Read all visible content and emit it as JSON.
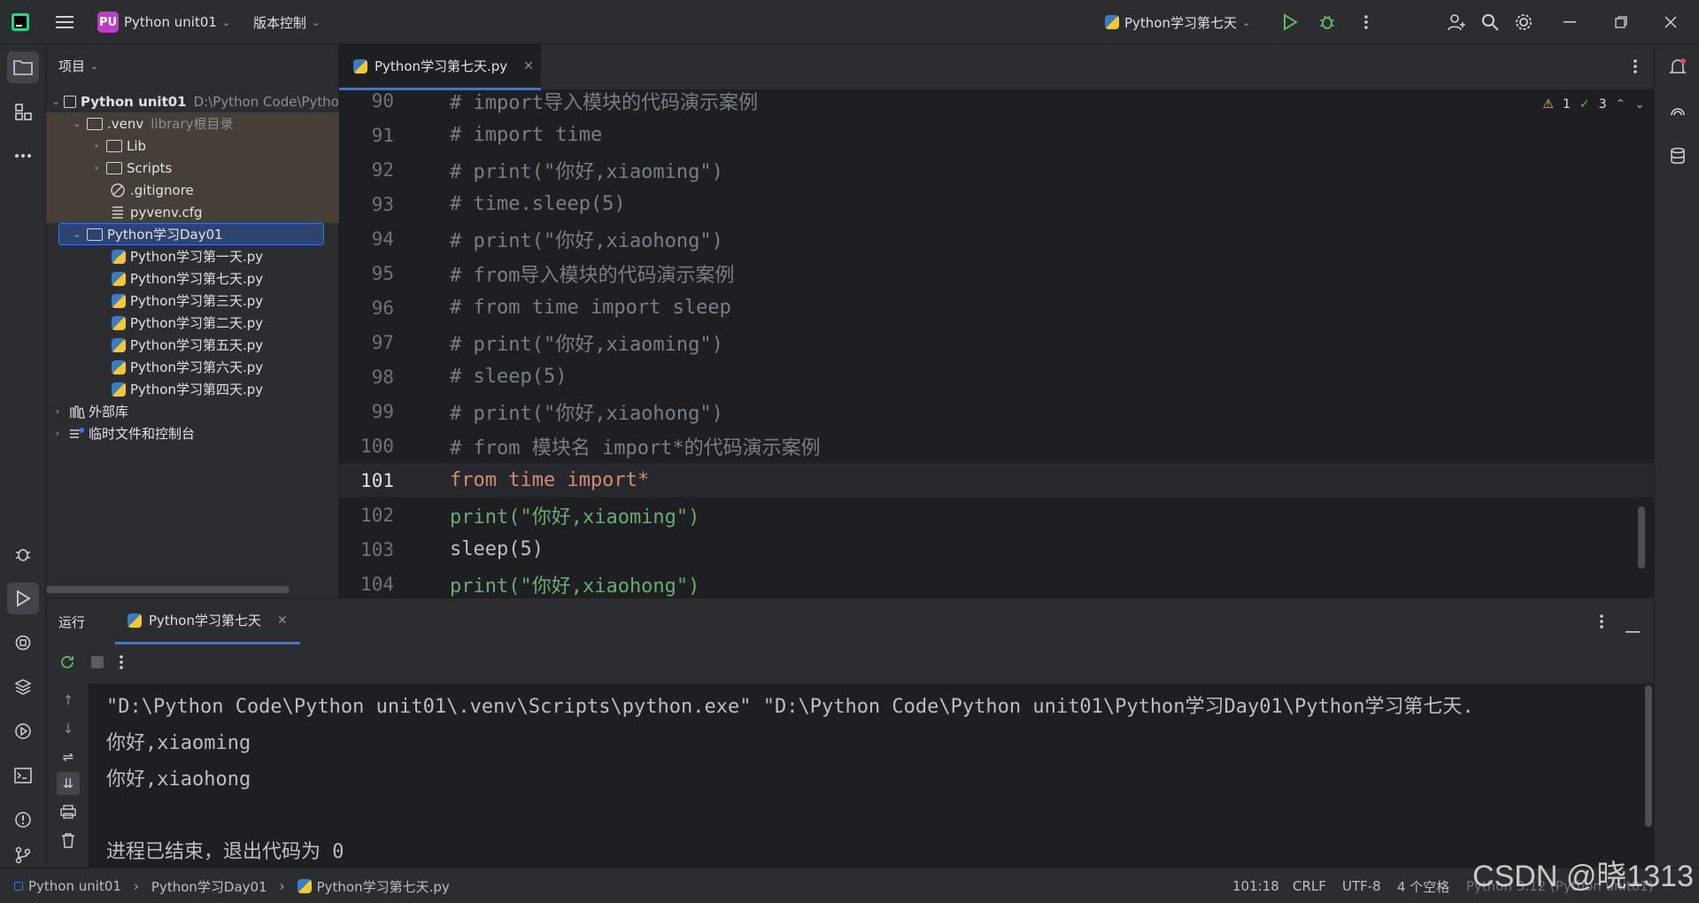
{
  "titlebar": {
    "project_badge": "PU",
    "project_name": "Python unit01",
    "vcs_label": "版本控制",
    "run_config": "Python学习第七天"
  },
  "project_panel": {
    "header": "项目",
    "tree": [
      {
        "label": "Python unit01",
        "sub": "D:\\Python Code\\Pytho",
        "type": "root"
      },
      {
        "label": ".venv",
        "sub": "library根目录",
        "type": "folder"
      },
      {
        "label": "Lib",
        "type": "folder"
      },
      {
        "label": "Scripts",
        "type": "folder"
      },
      {
        "label": ".gitignore",
        "type": "file"
      },
      {
        "label": "pyvenv.cfg",
        "type": "file"
      },
      {
        "label": "Python学习Day01",
        "type": "folder"
      },
      {
        "label": "Python学习第一天.py",
        "type": "py"
      },
      {
        "label": "Python学习第七天.py",
        "type": "py"
      },
      {
        "label": "Python学习第三天.py",
        "type": "py"
      },
      {
        "label": "Python学习第二天.py",
        "type": "py"
      },
      {
        "label": "Python学习第五天.py",
        "type": "py"
      },
      {
        "label": "Python学习第六天.py",
        "type": "py"
      },
      {
        "label": "Python学习第四天.py",
        "type": "py"
      },
      {
        "label": "外部库",
        "type": "lib"
      },
      {
        "label": "临时文件和控制台",
        "type": "scratch"
      }
    ]
  },
  "editor": {
    "tab_label": "Python学习第七天.py",
    "warnings": "1",
    "checks": "3",
    "lines": [
      {
        "n": "90",
        "text": "# import导入模块的代码演示案例"
      },
      {
        "n": "91",
        "text": "# import time"
      },
      {
        "n": "92",
        "text": "# print(\"你好,xiaoming\")"
      },
      {
        "n": "93",
        "text": "# time.sleep(5)"
      },
      {
        "n": "94",
        "text": "# print(\"你好,xiaohong\")"
      },
      {
        "n": "95",
        "text": "# from导入模块的代码演示案例"
      },
      {
        "n": "96",
        "text": "# from time import sleep"
      },
      {
        "n": "97",
        "text": "# print(\"你好,xiaoming\")"
      },
      {
        "n": "98",
        "text": "# sleep(5)"
      },
      {
        "n": "99",
        "text": "# print(\"你好,xiaohong\")"
      },
      {
        "n": "100",
        "text": "# from 模块名 import*的代码演示案例"
      },
      {
        "n": "101",
        "text": "from time import*"
      },
      {
        "n": "102",
        "text": "print(\"你好,xiaoming\")"
      },
      {
        "n": "103",
        "text": "sleep(5)"
      },
      {
        "n": "104",
        "text": "print(\"你好,xiaohong\")"
      }
    ]
  },
  "run_panel": {
    "title": "运行",
    "tab_label": "Python学习第七天",
    "console": [
      "\"D:\\Python Code\\Python unit01\\.venv\\Scripts\\python.exe\" \"D:\\Python Code\\Python unit01\\Python学习Day01\\Python学习第七天.",
      "你好,xiaoming",
      "你好,xiaohong",
      "",
      "进程已结束，退出代码为 0"
    ]
  },
  "statusbar": {
    "crumbs": [
      "Python unit01",
      "Python学习Day01",
      "Python学习第七天.py"
    ],
    "position": "101:18",
    "line_sep": "CRLF",
    "encoding": "UTF-8",
    "indent": "4 个空格",
    "interpreter": "Python 3.12 (Python unit01)"
  },
  "watermark": "CSDN @晓1313",
  "colors": {
    "accent": "#3574f0",
    "keyword": "#cf8e6d",
    "string": "#6aab73",
    "number": "#2aacb8",
    "comment": "#7a7e85",
    "builtin": "#8888c6"
  }
}
